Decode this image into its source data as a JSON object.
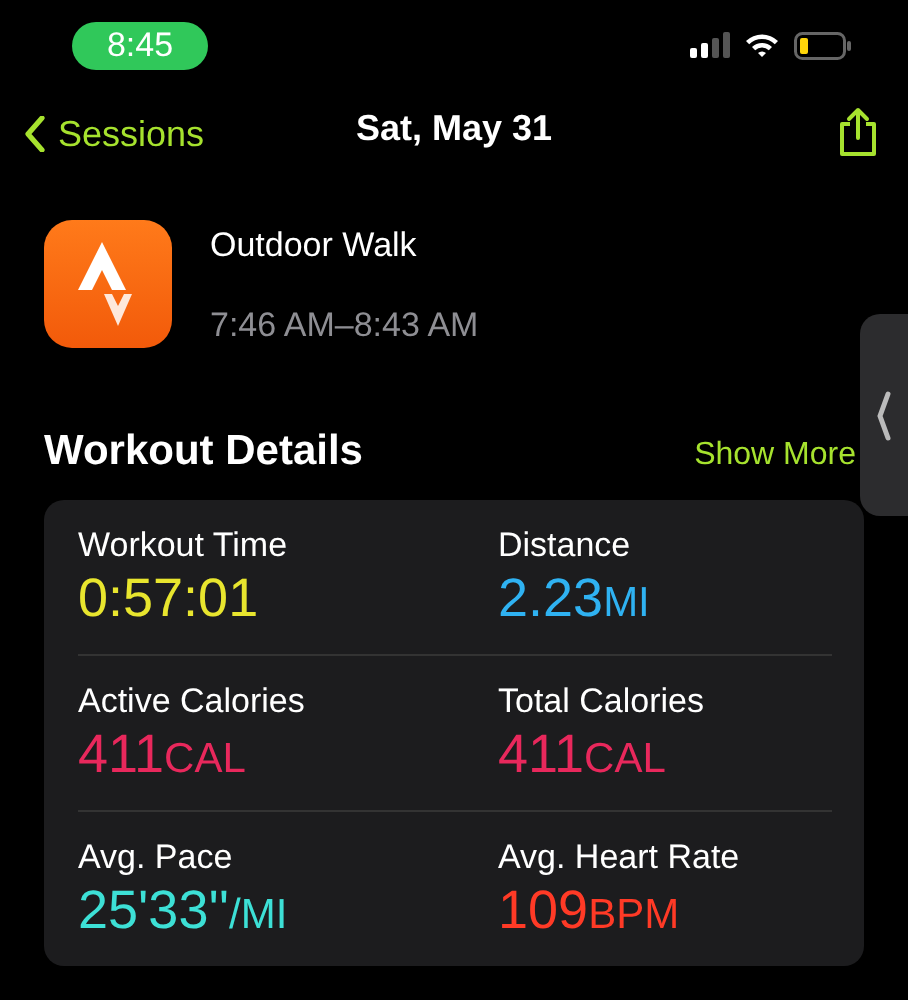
{
  "status_bar": {
    "time": "8:45"
  },
  "nav": {
    "back": "Sessions",
    "title": "Sat, May 31"
  },
  "workout": {
    "name": "Outdoor Walk",
    "time_range": "7:46 AM–8:43 AM"
  },
  "section": {
    "title": "Workout Details",
    "action": "Show More"
  },
  "metrics": [
    {
      "label": "Workout Time",
      "value": "0:57:01",
      "color": "#e8e52e"
    },
    {
      "label": "Distance",
      "value": "2.23",
      "unit": "MI",
      "color": "#2fb2f2"
    },
    {
      "label": "Active Calories",
      "value": "411",
      "unit": "CAL",
      "color": "#e8285c"
    },
    {
      "label": "Total Calories",
      "value": "411",
      "unit": "CAL",
      "color": "#e8285c"
    },
    {
      "label": "Avg. Pace",
      "value": "25'33''",
      "unit": "/MI",
      "color": "#3de0d6"
    },
    {
      "label": "Avg. Heart Rate",
      "value": "109",
      "unit": "BPM",
      "color": "#ff3a26"
    }
  ]
}
